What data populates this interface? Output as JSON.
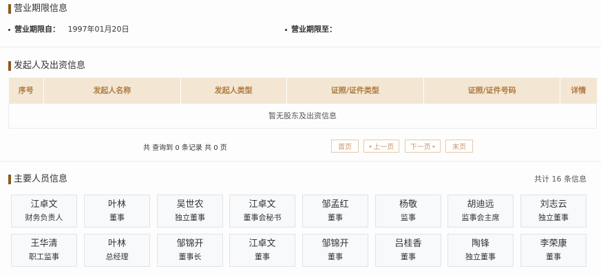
{
  "business_term": {
    "title": "营业期限信息",
    "from_label": "营业期限自：",
    "from_value": "1997年01月20日",
    "to_label": "营业期限至：",
    "to_value": ""
  },
  "investors": {
    "title": "发起人及出资信息",
    "columns": [
      "序号",
      "发起人名称",
      "发起人类型",
      "证照/证件类型",
      "证照/证件号码",
      "详情"
    ],
    "empty_text": "暂无股东及出资信息",
    "pager": {
      "info": "共 查询到 0 条记录 共 0 页",
      "first": "首页",
      "prev": "上一页",
      "next": "下一页",
      "last": "末页"
    }
  },
  "personnel": {
    "title": "主要人员信息",
    "count_text": "共计 16 条信息",
    "people": [
      {
        "name": "江卓文",
        "role": "财务负责人"
      },
      {
        "name": "叶林",
        "role": "董事"
      },
      {
        "name": "吴世农",
        "role": "独立董事"
      },
      {
        "name": "江卓文",
        "role": "董事会秘书"
      },
      {
        "name": "邹孟红",
        "role": "董事"
      },
      {
        "name": "杨敬",
        "role": "监事"
      },
      {
        "name": "胡迪远",
        "role": "监事会主席"
      },
      {
        "name": "刘志云",
        "role": "独立董事"
      },
      {
        "name": "王华清",
        "role": "职工监事"
      },
      {
        "name": "叶林",
        "role": "总经理"
      },
      {
        "name": "邹锦开",
        "role": "董事长"
      },
      {
        "name": "江卓文",
        "role": "董事"
      },
      {
        "name": "邹锦开",
        "role": "董事"
      },
      {
        "name": "吕桂香",
        "role": "董事"
      },
      {
        "name": "陶锋",
        "role": "独立董事"
      },
      {
        "name": "李荣康",
        "role": "董事"
      }
    ]
  }
}
